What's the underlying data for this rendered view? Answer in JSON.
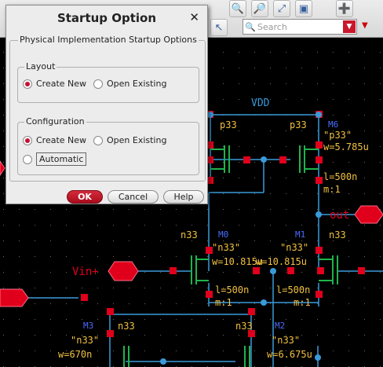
{
  "toolbar": {
    "search_placeholder": "Search",
    "buttons": [
      "zoom-in-icon",
      "zoom-out-icon",
      "zoom-fit-icon",
      "zoom-area-icon",
      "add-instance-icon"
    ]
  },
  "schematic": {
    "net_labels": {
      "vdd": "VDD",
      "vin_plus": "Vin+",
      "out": "out"
    },
    "devices": {
      "m6": {
        "name": "M6",
        "type_label": "p33",
        "model": "\"p33\"",
        "width": "w=5.785u",
        "length": "l=500n",
        "mult": "m:1"
      },
      "mp_left": {
        "type_label": "p33"
      },
      "m0": {
        "name": "M0",
        "type_label": "n33",
        "model": "\"n33\"",
        "width": "w=10.815u",
        "length": "l=500n",
        "mult": "m:1"
      },
      "m1": {
        "name": "M1",
        "type_label": "n33",
        "model": "\"n33\"",
        "width": "w=10.815u",
        "length": "l=500n",
        "mult": "m:1"
      },
      "m3": {
        "name": "M3",
        "type_label": "n33",
        "model": "\"n33\"",
        "width": "w=670n"
      },
      "m2": {
        "name": "M2",
        "type_label": "n33",
        "model": "\"n33\"",
        "width": "w=6.675u"
      }
    },
    "colors": {
      "wire": "#3a9ad9",
      "pin": "#e0001b",
      "device": "#1fb34c",
      "label": "#f0c040",
      "net": "#e0001b",
      "instance": "#4a6bff",
      "background": "#000000"
    }
  },
  "dialog": {
    "title": "Startup Option",
    "outer_group_label": "Physical Implementation Startup Options",
    "layout": {
      "label": "Layout",
      "options": [
        {
          "label": "Create New",
          "selected": true
        },
        {
          "label": "Open Existing",
          "selected": false
        }
      ]
    },
    "configuration": {
      "label": "Configuration",
      "options": [
        {
          "label": "Create New",
          "selected": true
        },
        {
          "label": "Open Existing",
          "selected": false
        }
      ],
      "automatic": {
        "label": "Automatic",
        "selected": false
      }
    },
    "buttons": {
      "ok": "OK",
      "cancel": "Cancel",
      "help": "Help"
    }
  }
}
